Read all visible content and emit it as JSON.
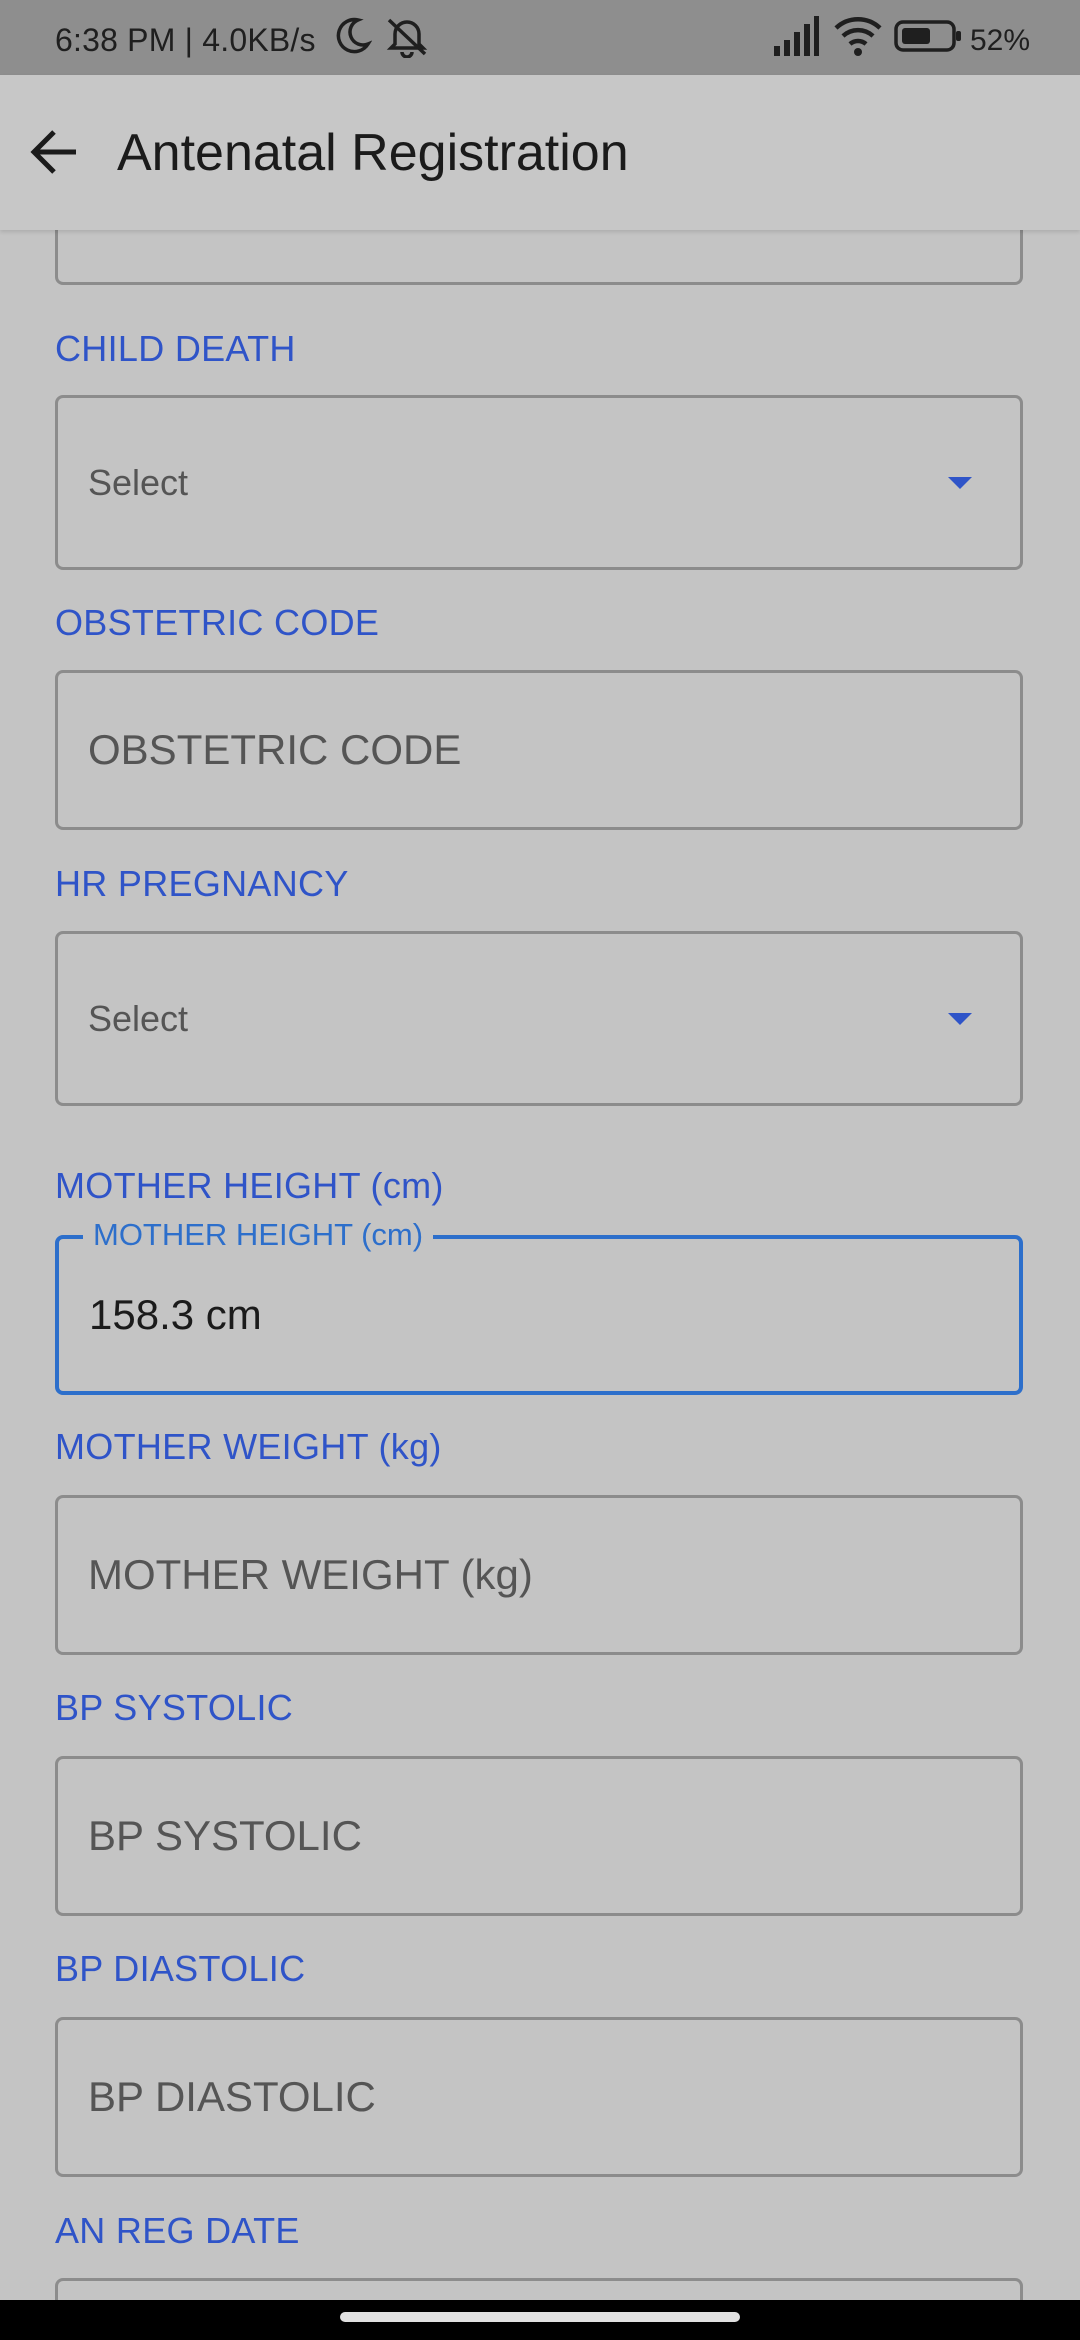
{
  "status_bar": {
    "left_text": "6:38 PM | 4.0KB/s",
    "battery_text": "52%",
    "icons": [
      "moon-icon",
      "bell-off-icon",
      "signal-icon",
      "wifi-icon",
      "battery-icon"
    ]
  },
  "app_bar": {
    "title": "Antenatal Registration",
    "back_icon": "arrow-left-icon"
  },
  "form": {
    "child_death": {
      "label": "CHILD DEATH",
      "value": "Select"
    },
    "obstetric_code": {
      "label": "OBSTETRIC CODE",
      "placeholder": "OBSTETRIC CODE"
    },
    "hr_pregnancy": {
      "label": "HR PREGNANCY",
      "value": "Select"
    },
    "mother_height": {
      "label": "MOTHER HEIGHT (cm)",
      "floating_label": "MOTHER HEIGHT (cm)",
      "value": "158.3 cm"
    },
    "mother_weight": {
      "label": "MOTHER WEIGHT (kg)",
      "placeholder": "MOTHER WEIGHT (kg)"
    },
    "bp_systolic": {
      "label": "BP SYSTOLIC",
      "placeholder": "BP SYSTOLIC"
    },
    "bp_diastolic": {
      "label": "BP DIASTOLIC",
      "placeholder": "BP DIASTOLIC"
    },
    "an_reg_date": {
      "label": "AN REG DATE"
    }
  },
  "colors": {
    "label_blue": "#2f54c8",
    "focus_blue": "#2d6fcb",
    "background": "#c4c4c4",
    "status_bar": "#8e8e8e"
  }
}
